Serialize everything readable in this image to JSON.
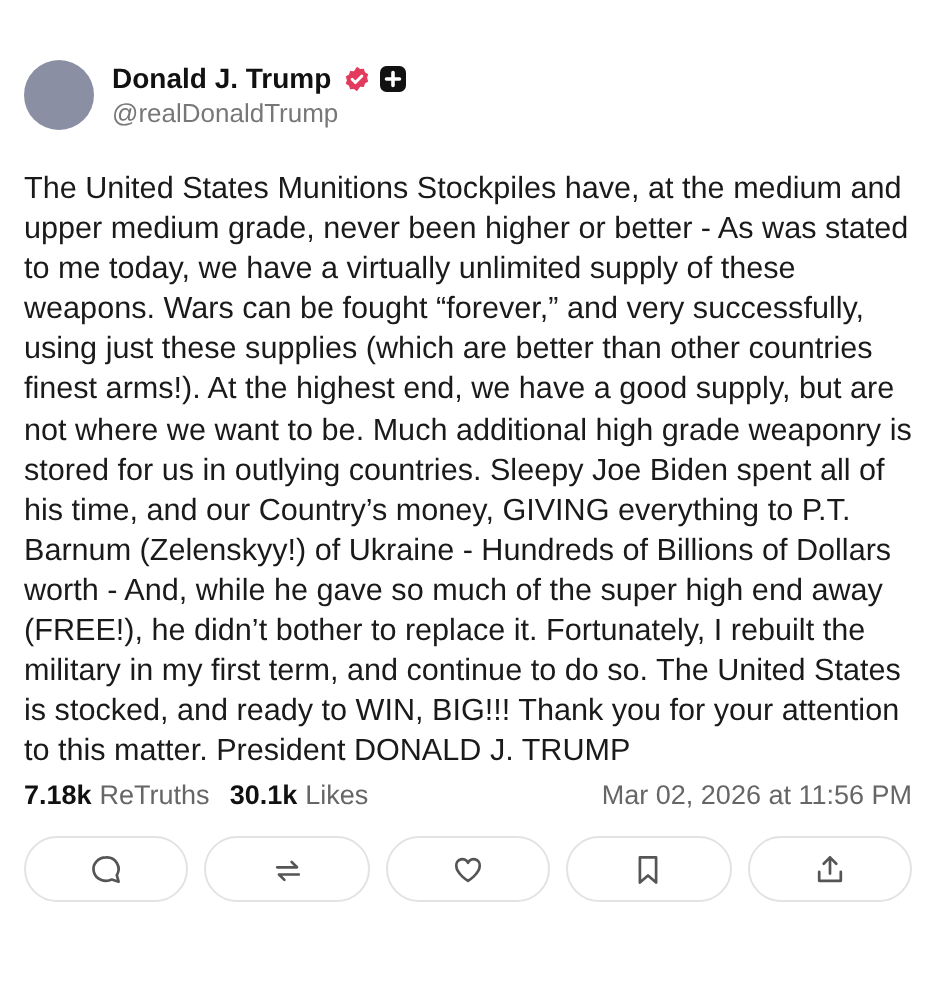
{
  "post": {
    "author": {
      "name": "Donald J. Trump",
      "handle": "@realDonaldTrump"
    },
    "text": "The United States Munitions Stockpiles have, at the medium and upper medium grade, never been higher or better - As was stated to me today, we have a virtually unlimited supply of these weapons. Wars can be fought “forever,” and very successfully, using just these supplies (which are better than other countries finest arms!). At the highest end, we have a good supply, but are not where we want to be. Much additional high grade weaponry is stored for us in outlying countries. Sleepy Joe Biden spent all of his time, and our Country’s money, GIVING everything to P.T. Barnum (Zelenskyy!) of Ukraine - Hundreds of Billions of Dollars worth - And, while he gave so much of the super high end away (FREE!), he didn’t bother to replace it. Fortunately, I rebuilt the military in my first term, and continue to do so. The United States is stocked, and ready to WIN, BIG!!! Thank you for your attention to this matter. President DONALD J. TRUMP",
    "stats": [
      {
        "count": "7.18k",
        "label": "ReTruths"
      },
      {
        "count": "30.1k",
        "label": "Likes"
      }
    ],
    "timestamp": "Mar 02, 2026 at 11:56 PM"
  }
}
